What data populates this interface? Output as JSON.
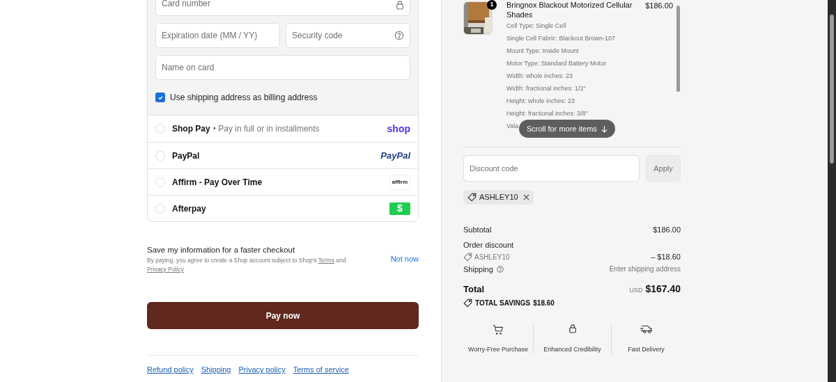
{
  "card_fields": [
    {
      "placeholder": "Card number"
    },
    {
      "placeholder": "Expiration date (MM / YY)"
    },
    {
      "placeholder": "Security code"
    },
    {
      "placeholder": "Name on card"
    }
  ],
  "billing_same": {
    "label": "Use shipping address as billing address",
    "checked": true
  },
  "payment_methods": [
    {
      "name": "Shop Pay",
      "note": "• Pay in full or in installments",
      "selected": false,
      "logo_text": "shop"
    },
    {
      "name": "PayPal",
      "selected": false,
      "logo_text": "PayPal"
    },
    {
      "name": "Affirm - Pay Over Time",
      "selected": false,
      "logo_text": "affirm"
    },
    {
      "name": "Afterpay",
      "selected": false,
      "logo_text": "$"
    }
  ],
  "save_info": {
    "title": "Save my information for a faster checkout",
    "text": "By paying, you agree to create a Shop account subject to Shop's",
    "terms": "Terms",
    "and": "and",
    "privacy": "Privacy Policy",
    "action": "Not now"
  },
  "pay_button": "Pay now",
  "footer_links": [
    "Refund policy",
    "Shipping",
    "Privacy policy",
    "Terms of service"
  ],
  "item": {
    "quantity": "1",
    "title": "Bringnox Blackout Motorized Cellular Shades",
    "price": "$186.00",
    "options": [
      "Cell Type: Single Cell",
      "Single Cell Fabric: Blackout Brown-107",
      "Mount Type: Inside Mount",
      "Motor Type: Standard Battery Motor",
      "Width: whole inches: 23",
      "Width: fractional inches: 1/2\"",
      "Height: whole inches: 23",
      "Height: fractional inches: 3/8\"",
      "Vala"
    ]
  },
  "scroll_hint": "Scroll for more items",
  "discount": {
    "placeholder": "Discount code",
    "button": "Apply",
    "applied": "ASHLEY10"
  },
  "summary": {
    "subtotal_label": "Subtotal",
    "subtotal": "$186.00",
    "discount_label": "Order discount",
    "discount_code": "ASHLEY10",
    "discount": "– $18.60",
    "shipping_label": "Shipping",
    "shipping": "Enter shipping address",
    "total_label": "Total",
    "currency": "USD",
    "total": "$167.40",
    "savings_label": "TOTAL SAVINGS",
    "savings": "$18.60"
  },
  "badges": [
    {
      "label": "Worry-Free Purchase"
    },
    {
      "label": "Enhanced Credibility"
    },
    {
      "label": "Fast Delivery"
    }
  ]
}
